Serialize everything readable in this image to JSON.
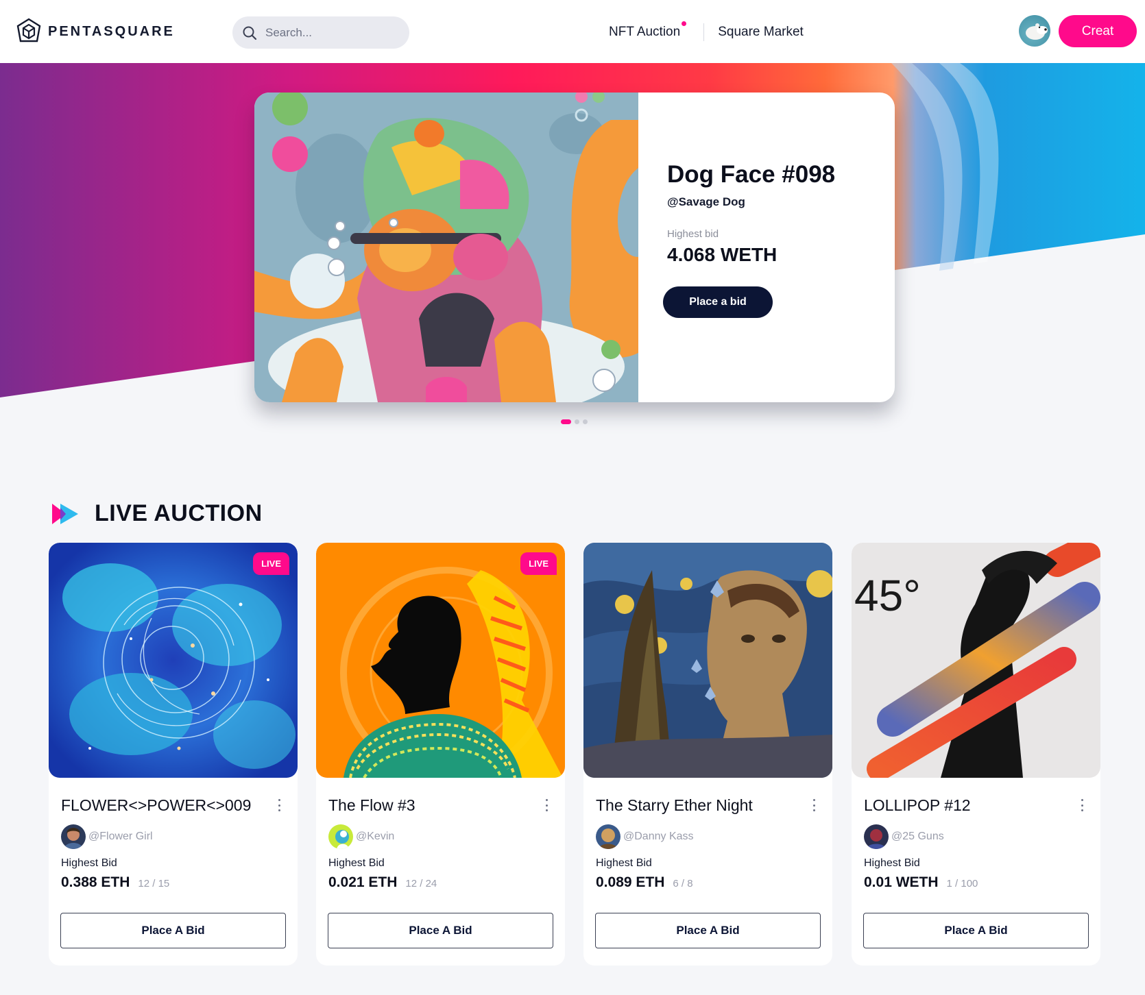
{
  "brand": {
    "name": "PENTASQUARE"
  },
  "search": {
    "placeholder": "Search..."
  },
  "nav": {
    "items": [
      {
        "label": "NFT Auction"
      },
      {
        "label": "Square Market"
      }
    ]
  },
  "header": {
    "create_label": "Creat"
  },
  "colors": {
    "accent": "#ff0a8b",
    "navy": "#0c1535",
    "background": "#f5f6f9"
  },
  "hero": {
    "title": "Dog Face #098",
    "owner": "@Savage Dog",
    "bid_label": "Highest bid",
    "bid_value": "4.068 WETH",
    "button_label": "Place a bid",
    "slide_count": 3,
    "active_slide": 1
  },
  "section": {
    "title": "LIVE AUCTION",
    "icon": "play-forward-icon"
  },
  "cards": [
    {
      "title": "FLOWER<>POWER<>009",
      "owner": "@Flower Girl",
      "bid_label": "Highest Bid",
      "bid_value": "0.388 ETH",
      "edition": "12 / 15",
      "live": "LIVE",
      "button_label": "Place A Bid"
    },
    {
      "title": "The Flow #3",
      "owner": "@Kevin",
      "bid_label": "Highest Bid",
      "bid_value": "0.021 ETH",
      "edition": "12 / 24",
      "live": "LIVE",
      "button_label": "Place A Bid"
    },
    {
      "title": "The Starry Ether Night",
      "owner": "@Danny Kass",
      "bid_label": "Highest Bid",
      "bid_value": "0.089 ETH",
      "edition": "6 / 8",
      "live": "",
      "button_label": "Place A Bid"
    },
    {
      "title": "LOLLIPOP #12",
      "owner": "@25 Guns",
      "bid_label": "Highest Bid",
      "bid_value": "0.01 WETH",
      "edition": "1 / 100",
      "live": "",
      "button_label": "Place A Bid",
      "art_text": "45°"
    }
  ]
}
